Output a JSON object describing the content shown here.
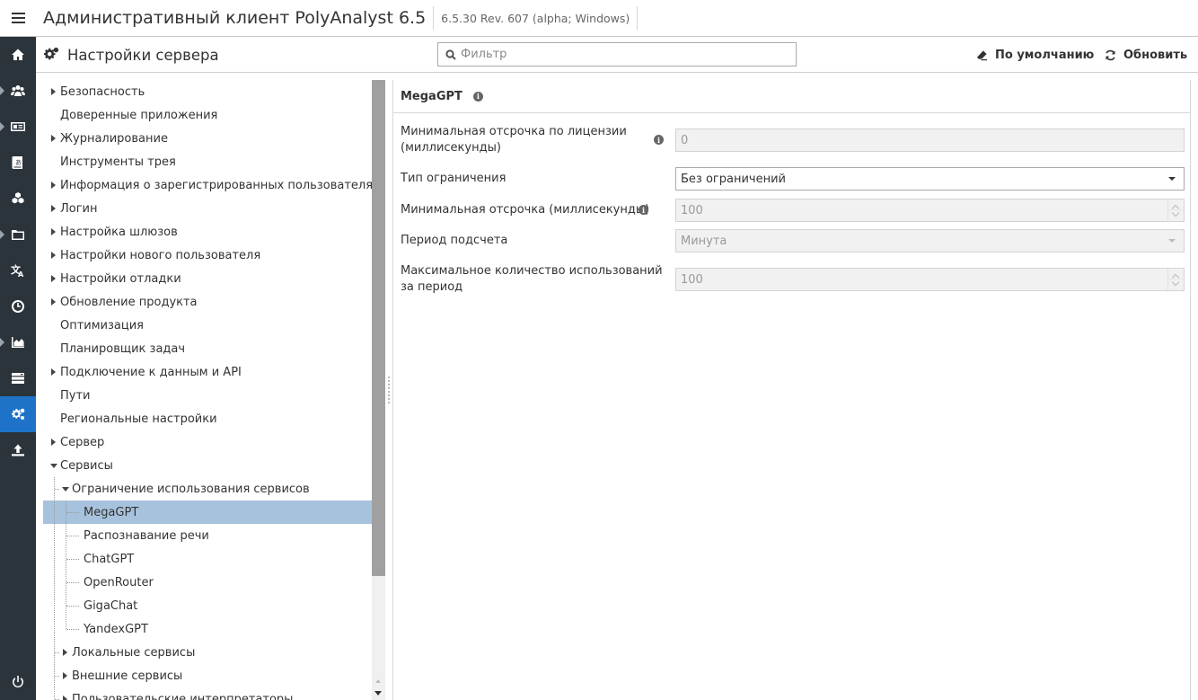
{
  "app": {
    "title": "Административный клиент PolyAnalyst 6.5",
    "version": "6.5.30 Rev. 607 (alpha; Windows)"
  },
  "iconbar": {
    "items": [
      {
        "icon": "home-icon",
        "caret": false,
        "active": false
      },
      {
        "icon": "users-icon",
        "caret": true,
        "active": false
      },
      {
        "icon": "id-card-icon",
        "caret": true,
        "active": false
      },
      {
        "icon": "translate-book-icon",
        "caret": false,
        "active": false
      },
      {
        "icon": "cubes-icon",
        "caret": false,
        "active": false
      },
      {
        "icon": "folder-icon",
        "caret": true,
        "active": false
      },
      {
        "icon": "language-icon",
        "caret": false,
        "active": false
      },
      {
        "icon": "clock-icon",
        "caret": false,
        "active": false
      },
      {
        "icon": "area-chart-icon",
        "caret": true,
        "active": false
      },
      {
        "icon": "server-icon",
        "caret": false,
        "active": false
      },
      {
        "icon": "gears-icon",
        "caret": false,
        "active": true
      },
      {
        "icon": "upload-icon",
        "caret": false,
        "active": false
      }
    ],
    "bottom_icon": "power-icon",
    "active_color": "#1e73c8",
    "bg_color": "#2b333b"
  },
  "header": {
    "title": "Настройки сервера",
    "filter_placeholder": "Фильтр",
    "default_label": "По умолчанию",
    "refresh_label": "Обновить"
  },
  "tree": {
    "items": [
      {
        "label": "Безопасность",
        "level": 0,
        "toggle": "collapsed"
      },
      {
        "label": "Доверенные приложения",
        "level": 0,
        "toggle": "none"
      },
      {
        "label": "Журналирование",
        "level": 0,
        "toggle": "collapsed"
      },
      {
        "label": "Инструменты трея",
        "level": 0,
        "toggle": "none"
      },
      {
        "label": "Информация о зарегистрированных пользователях",
        "level": 0,
        "toggle": "collapsed"
      },
      {
        "label": "Логин",
        "level": 0,
        "toggle": "collapsed"
      },
      {
        "label": "Настройка шлюзов",
        "level": 0,
        "toggle": "collapsed"
      },
      {
        "label": "Настройки нового пользователя",
        "level": 0,
        "toggle": "collapsed"
      },
      {
        "label": "Настройки отладки",
        "level": 0,
        "toggle": "collapsed"
      },
      {
        "label": "Обновление продукта",
        "level": 0,
        "toggle": "collapsed"
      },
      {
        "label": "Оптимизация",
        "level": 0,
        "toggle": "none"
      },
      {
        "label": "Планировщик задач",
        "level": 0,
        "toggle": "none"
      },
      {
        "label": "Подключение к данным и API",
        "level": 0,
        "toggle": "collapsed"
      },
      {
        "label": "Пути",
        "level": 0,
        "toggle": "none"
      },
      {
        "label": "Региональные настройки",
        "level": 0,
        "toggle": "none"
      },
      {
        "label": "Сервер",
        "level": 0,
        "toggle": "collapsed"
      },
      {
        "label": "Сервисы",
        "level": 0,
        "toggle": "expanded"
      },
      {
        "label": "Ограничение использования сервисов",
        "level": 1,
        "toggle": "expanded"
      },
      {
        "label": "MegaGPT",
        "level": 2,
        "toggle": "none",
        "selected": true
      },
      {
        "label": "Распознавание речи",
        "level": 2,
        "toggle": "none"
      },
      {
        "label": "ChatGPT",
        "level": 2,
        "toggle": "none"
      },
      {
        "label": "OpenRouter",
        "level": 2,
        "toggle": "none"
      },
      {
        "label": "GigaChat",
        "level": 2,
        "toggle": "none"
      },
      {
        "label": "YandexGPT",
        "level": 2,
        "toggle": "none"
      },
      {
        "label": "Локальные сервисы",
        "level": 1,
        "toggle": "collapsed"
      },
      {
        "label": "Внешние сервисы",
        "level": 1,
        "toggle": "collapsed"
      },
      {
        "label": "Пользовательские интерпретаторы",
        "level": 1,
        "toggle": "collapsed"
      }
    ],
    "selected_color": "#a7c2dc"
  },
  "section": {
    "title": "MegaGPT",
    "properties": [
      {
        "label": "Минимальная отсрочка по лицензии (миллисекунды)",
        "value": "0",
        "kind": "text",
        "enabled": false,
        "info": true
      },
      {
        "label": "Тип ограничения",
        "value": "Без ограничений",
        "kind": "select",
        "enabled": true,
        "info": false
      },
      {
        "label": "Минимальная отсрочка (миллисекунды)",
        "value": "100",
        "kind": "number",
        "enabled": false,
        "info": true
      },
      {
        "label": "Период подсчета",
        "value": "Минута",
        "kind": "select",
        "enabled": false,
        "info": false
      },
      {
        "label": "Максимальное количество использований за период",
        "value": "100",
        "kind": "number",
        "enabled": false,
        "info": false
      }
    ]
  }
}
